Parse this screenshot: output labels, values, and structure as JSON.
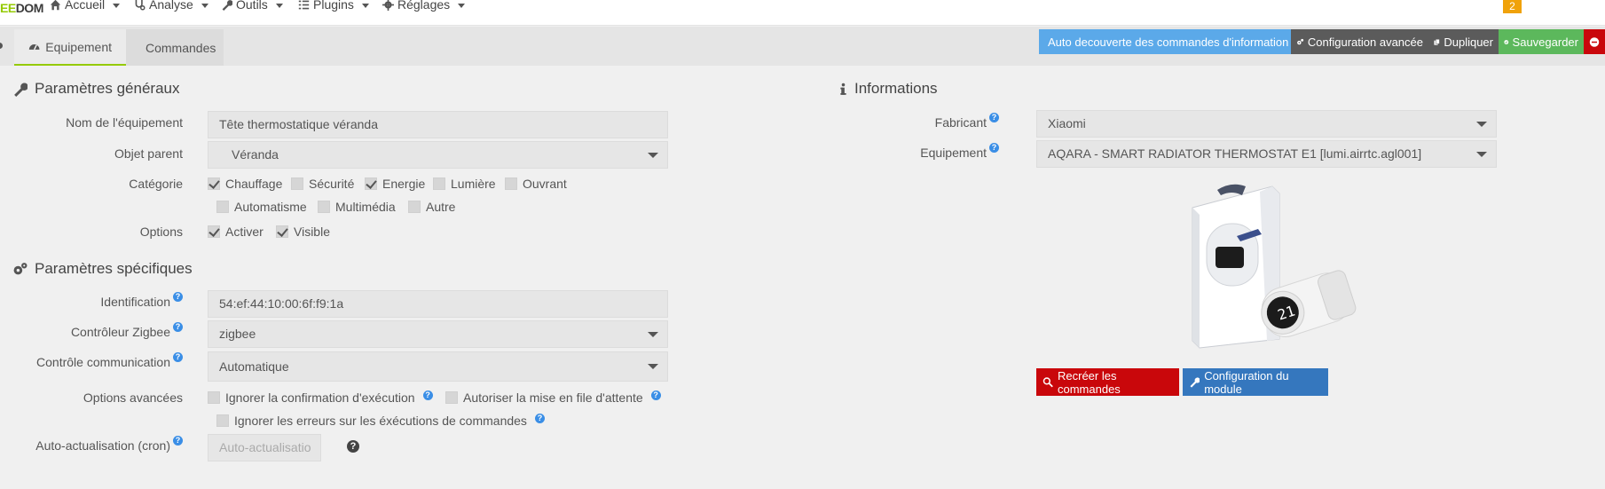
{
  "brand": {
    "part1": "EE",
    "part2": "DOM"
  },
  "nav": {
    "accueil": "Accueil",
    "analyse": "Analyse",
    "outils": "Outils",
    "plugins": "Plugins",
    "reglages": "Réglages",
    "badge": "2"
  },
  "tabs": {
    "equipement": "Equipement",
    "commandes": "Commandes"
  },
  "actions": {
    "auto_discovery": "Auto decouverte des commandes d'information",
    "advanced_config": "Configuration avancée",
    "duplicate": "Dupliquer",
    "save": "Sauvegarder"
  },
  "general": {
    "title": "Paramètres généraux",
    "name_label": "Nom de l'équipement",
    "name_value": "Tête thermostatique véranda",
    "parent_label": "Objet parent",
    "parent_value": "Véranda",
    "category_label": "Catégorie",
    "categories": [
      {
        "label": "Chauffage",
        "checked": true
      },
      {
        "label": "Sécurité",
        "checked": false
      },
      {
        "label": "Energie",
        "checked": true
      },
      {
        "label": "Lumière",
        "checked": false
      },
      {
        "label": "Ouvrant",
        "checked": false
      },
      {
        "label": "Automatisme",
        "checked": false
      },
      {
        "label": "Multimédia",
        "checked": false
      },
      {
        "label": "Autre",
        "checked": false
      }
    ],
    "options_label": "Options",
    "options": [
      {
        "label": "Activer",
        "checked": true
      },
      {
        "label": "Visible",
        "checked": true
      }
    ]
  },
  "specific": {
    "title": "Paramètres spécifiques",
    "id_label": "Identification",
    "id_value": "54:ef:44:10:00:6f:f9:1a",
    "controller_label": "Contrôleur Zigbee",
    "controller_value": "zigbee",
    "comm_label": "Contrôle communication",
    "comm_value": "Automatique",
    "adv_label": "Options avancées",
    "adv_opt1": "Ignorer la confirmation d'exécution",
    "adv_opt2": "Autoriser la mise en file d'attente",
    "adv_opt3": "Ignorer les erreurs sur les éxécutions de commandes",
    "cron_label": "Auto-actualisation (cron)",
    "cron_placeholder": "Auto-actualisatio"
  },
  "info": {
    "title": "Informations",
    "maker_label": "Fabricant",
    "maker_value": "Xiaomi",
    "device_label": "Equipement",
    "device_value": "AQARA - SMART RADIATOR THERMOSTAT E1 [lumi.airrtc.agl001]",
    "recreate": "Recréer les commandes",
    "module_config": "Configuration du module"
  },
  "colors": {
    "accent_green": "#94ca02",
    "btn_blue_light": "#5ba9e9",
    "btn_dark": "#5b5b5b",
    "btn_green": "#5cb85c",
    "btn_red": "#c9070b",
    "btn_blue": "#3577be"
  }
}
